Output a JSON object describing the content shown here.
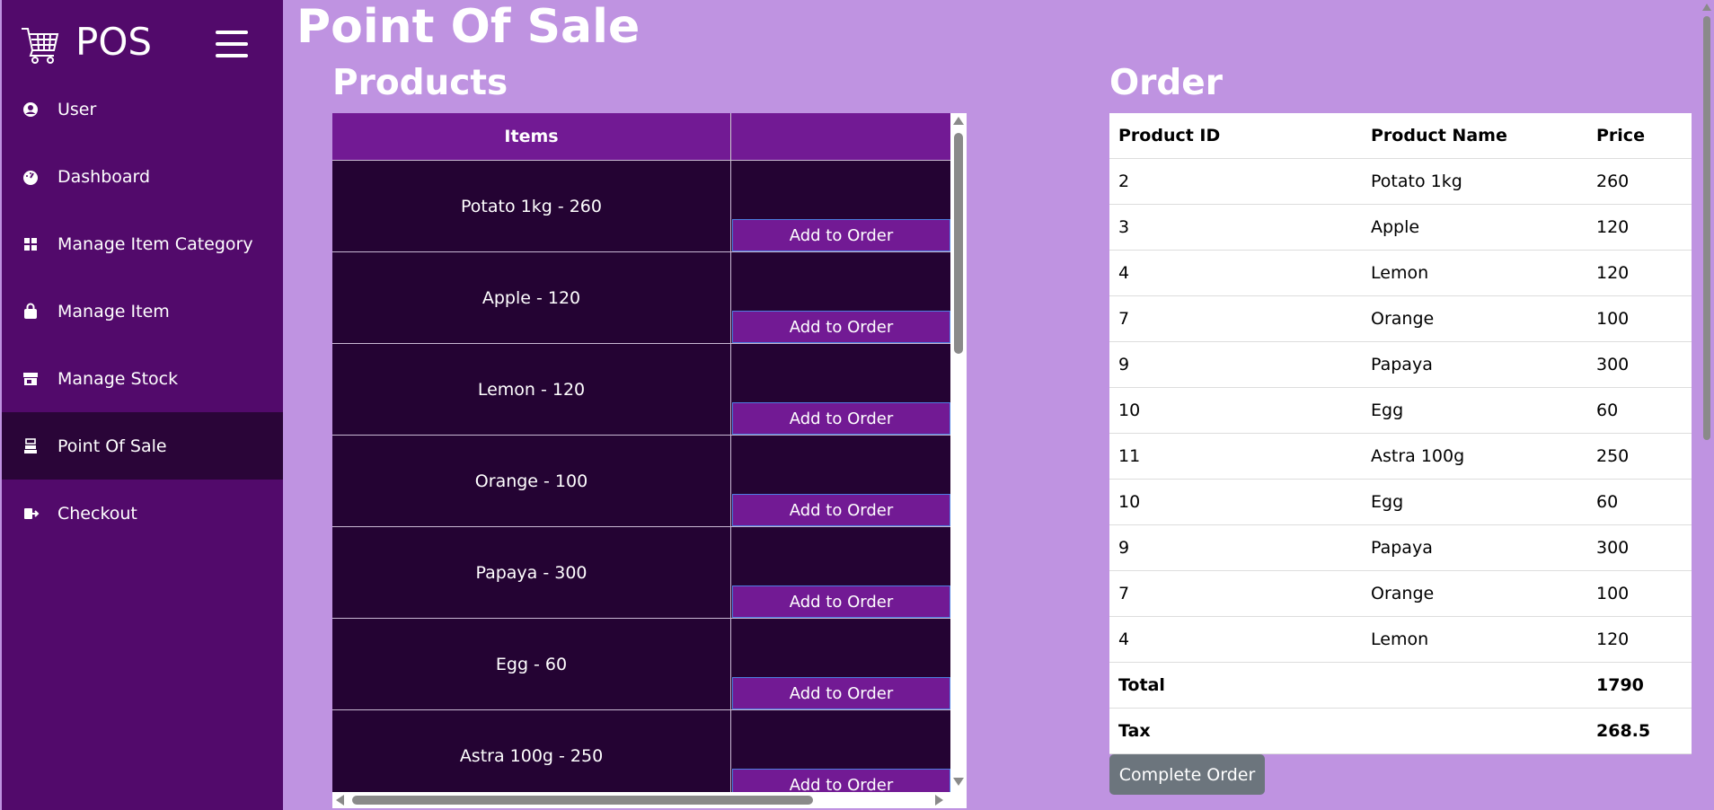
{
  "app": {
    "brand": "POS",
    "page_title": "Point Of Sale"
  },
  "sidebar": {
    "items": [
      {
        "label": "User",
        "icon": "user-circle-icon"
      },
      {
        "label": "Dashboard",
        "icon": "gauge-icon"
      },
      {
        "label": "Manage Item Category",
        "icon": "grid-icon"
      },
      {
        "label": "Manage Item",
        "icon": "shopping-bag-icon"
      },
      {
        "label": "Manage Stock",
        "icon": "store-icon"
      },
      {
        "label": "Point Of Sale",
        "icon": "cash-register-icon",
        "active": true
      },
      {
        "label": "Checkout",
        "icon": "sign-out-icon"
      }
    ]
  },
  "products": {
    "title": "Products",
    "header_items": "Items",
    "header_action": "",
    "button_label": "Add to Order",
    "rows": [
      "Potato 1kg - 260",
      "Apple - 120",
      "Lemon - 120",
      "Orange - 100",
      "Papaya - 300",
      "Egg - 60",
      "Astra 100g - 250"
    ]
  },
  "order": {
    "title": "Order",
    "headers": [
      "Product ID",
      "Product Name",
      "Price"
    ],
    "rows": [
      [
        "2",
        "Potato 1kg",
        "260"
      ],
      [
        "3",
        "Apple",
        "120"
      ],
      [
        "4",
        "Lemon",
        "120"
      ],
      [
        "7",
        "Orange",
        "100"
      ],
      [
        "9",
        "Papaya",
        "300"
      ],
      [
        "10",
        "Egg",
        "60"
      ],
      [
        "11",
        "Astra 100g",
        "250"
      ],
      [
        "10",
        "Egg",
        "60"
      ],
      [
        "9",
        "Papaya",
        "300"
      ],
      [
        "7",
        "Orange",
        "100"
      ],
      [
        "4",
        "Lemon",
        "120"
      ]
    ],
    "total_label": "Total",
    "total_value": "1790",
    "tax_label": "Tax",
    "tax_value": "268.5",
    "complete_button": "Complete Order"
  },
  "colors": {
    "page_bg": "#bf93e1",
    "sidebar_bg": "#520a6b",
    "sidebar_active": "#2a0538",
    "product_row_bg": "#240333",
    "accent": "#721a94",
    "complete_button": "#6c757d"
  }
}
